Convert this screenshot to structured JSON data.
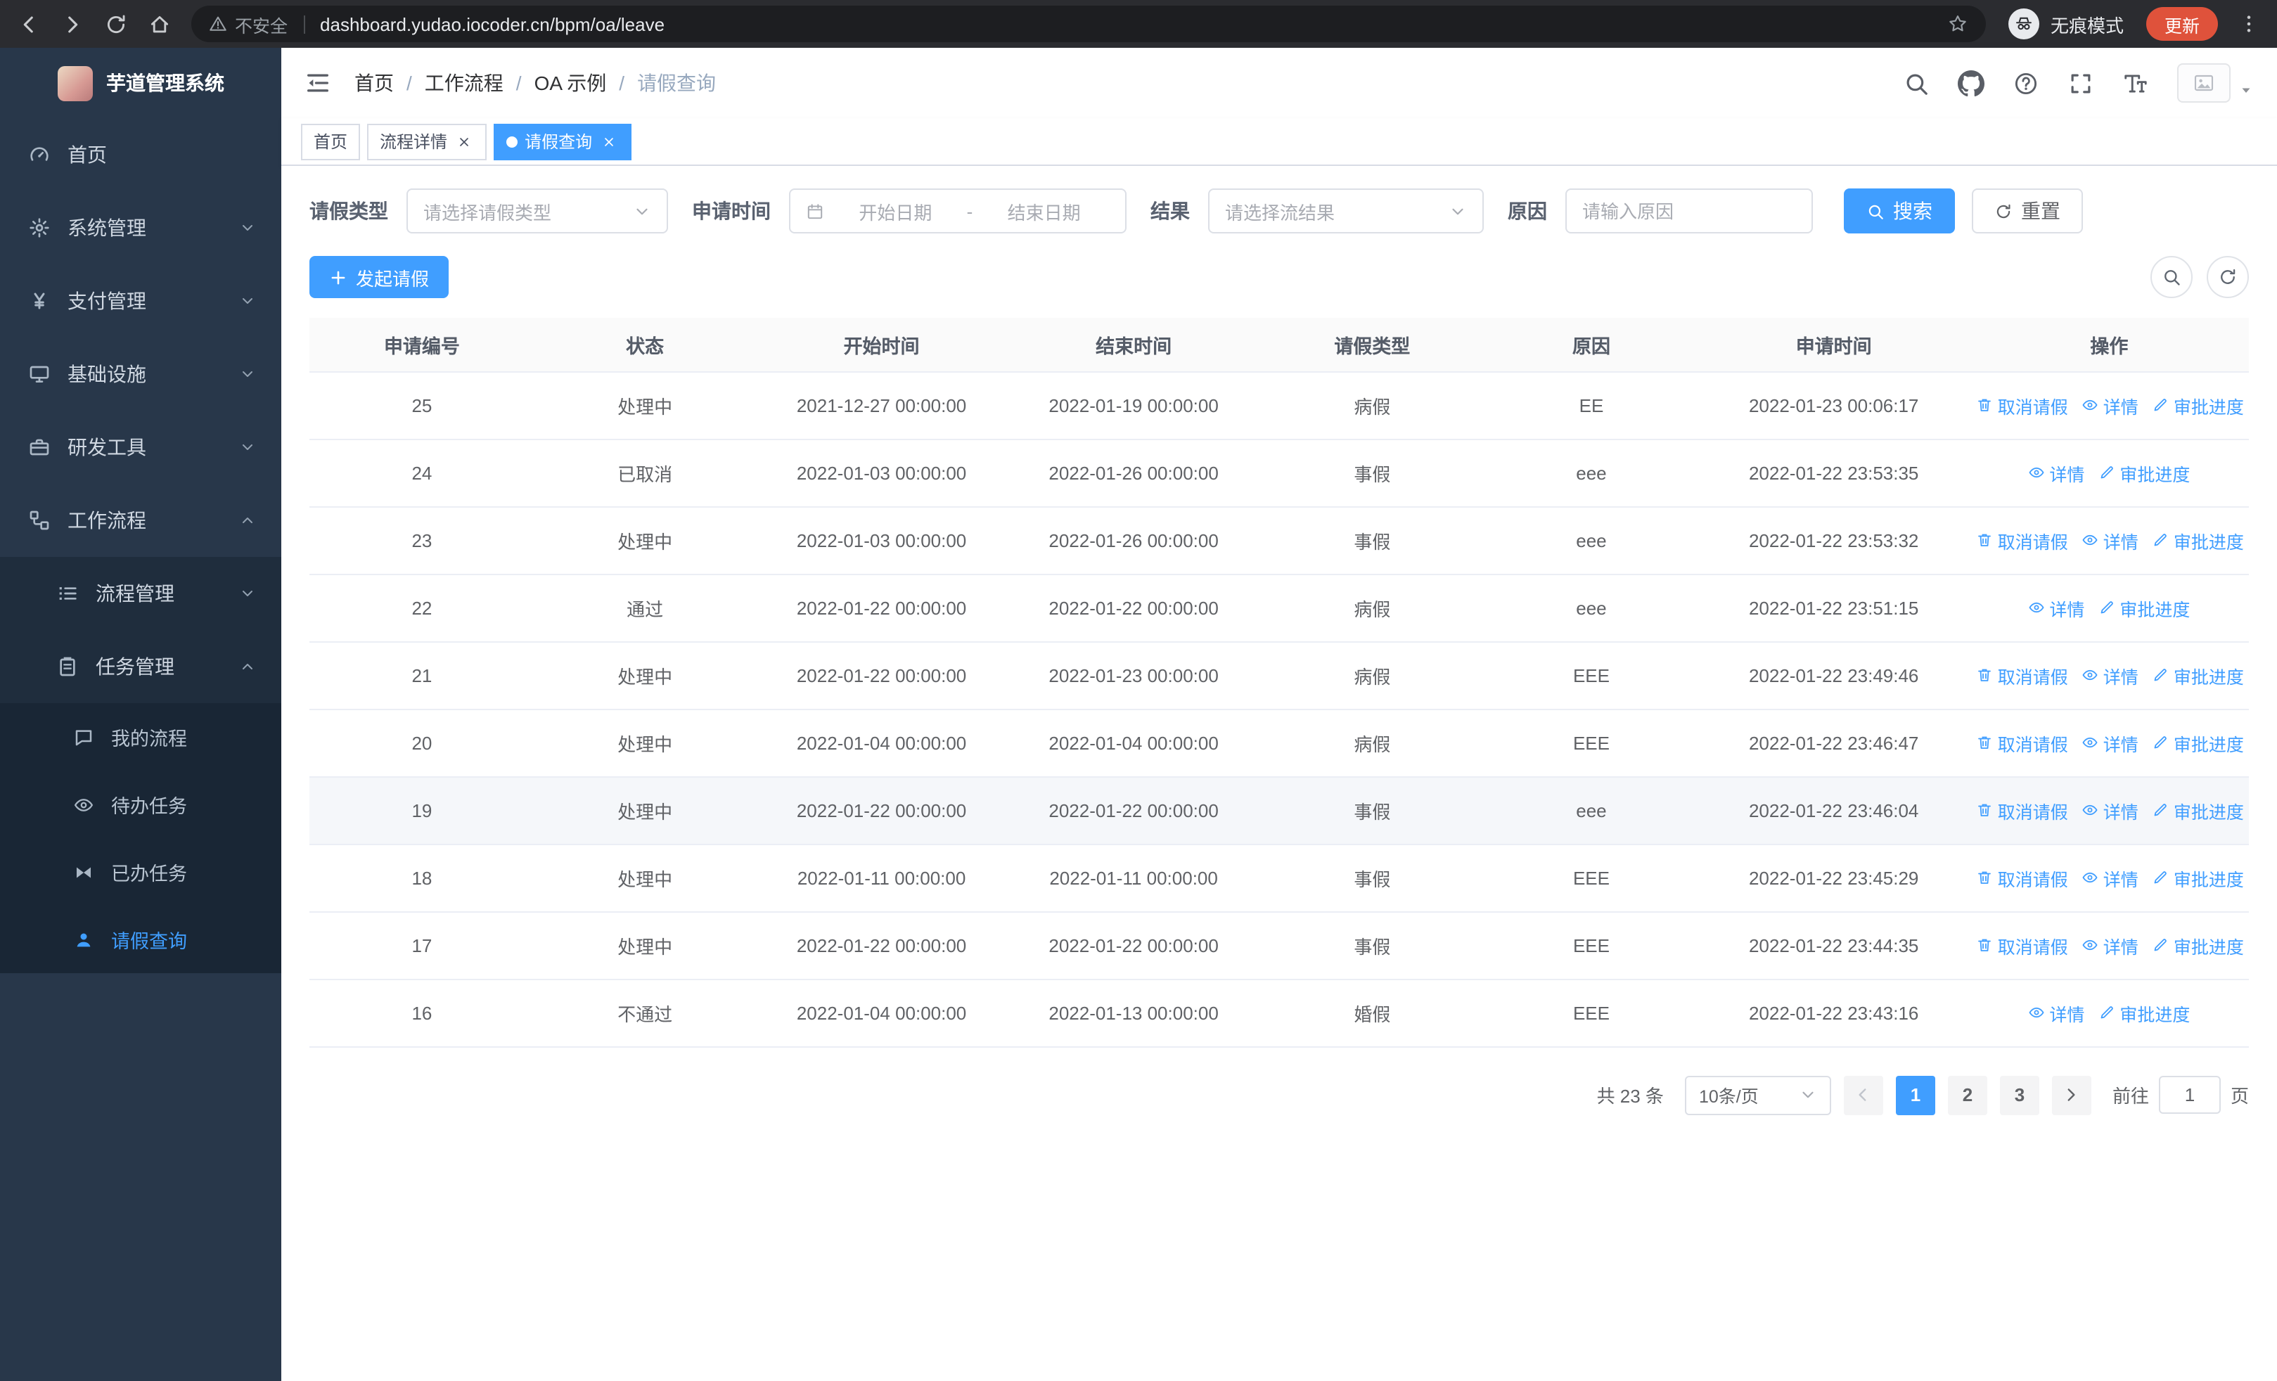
{
  "colors": {
    "accent": "#409eff",
    "update_button": "#df523b",
    "sidebar_bg": "#28374a",
    "sidebar_sub_bg": "#1f2d3d",
    "sidebar_sub2_bg": "#192635",
    "table_highlight": "#f5f7fa"
  },
  "browser": {
    "security_warning": "不安全",
    "url": "dashboard.yudao.iocoder.cn/bpm/oa/leave",
    "incognito_label": "无痕模式",
    "update_label": "更新"
  },
  "sidebar": {
    "title": "芋道管理系统",
    "menu": [
      {
        "label": "首页",
        "icon": "dashboard-icon",
        "level": 1
      },
      {
        "label": "系统管理",
        "icon": "gear-icon",
        "level": 1,
        "arrow": "down"
      },
      {
        "label": "支付管理",
        "icon": "payment-icon",
        "level": 1,
        "arrow": "down"
      },
      {
        "label": "基础设施",
        "icon": "monitor-icon",
        "level": 1,
        "arrow": "down"
      },
      {
        "label": "研发工具",
        "icon": "toolbox-icon",
        "level": 1,
        "arrow": "down"
      },
      {
        "label": "工作流程",
        "icon": "workflow-icon",
        "level": 1,
        "arrow": "up",
        "open": true
      },
      {
        "label": "流程管理",
        "icon": "list-icon",
        "level": 2,
        "arrow": "down"
      },
      {
        "label": "任务管理",
        "icon": "clipboard-icon",
        "level": 2,
        "arrow": "up",
        "open": true
      },
      {
        "label": "我的流程",
        "icon": "chat-icon",
        "level": 3
      },
      {
        "label": "待办任务",
        "icon": "eye-icon",
        "level": 3
      },
      {
        "label": "已办任务",
        "icon": "bowtie-icon",
        "level": 3
      },
      {
        "label": "请假查询",
        "icon": "user-icon",
        "level": 3,
        "active": true
      }
    ]
  },
  "header": {
    "breadcrumb": [
      "首页",
      "工作流程",
      "OA 示例",
      "请假查询"
    ],
    "breadcrumb_separator": "/",
    "icons": [
      "search-icon",
      "github-icon",
      "question-icon",
      "fullscreen-icon",
      "font-size-icon"
    ]
  },
  "tabs": [
    {
      "label": "首页",
      "closable": false,
      "active": false
    },
    {
      "label": "流程详情",
      "closable": true,
      "active": false
    },
    {
      "label": "请假查询",
      "closable": true,
      "active": true
    }
  ],
  "filters": {
    "leave_type_label": "请假类型",
    "leave_type_placeholder": "请选择请假类型",
    "apply_time_label": "申请时间",
    "start_placeholder": "开始日期",
    "range_separator": "-",
    "end_placeholder": "结束日期",
    "result_label": "结果",
    "result_placeholder": "请选择流结果",
    "reason_label": "原因",
    "reason_placeholder": "请输入原因",
    "search_button": "搜索",
    "reset_button": "重置"
  },
  "toolbar": {
    "create_button": "发起请假"
  },
  "table": {
    "columns": [
      "申请编号",
      "状态",
      "开始时间",
      "结束时间",
      "请假类型",
      "原因",
      "申请时间",
      "操作"
    ],
    "action_labels": {
      "cancel": "取消请假",
      "detail": "详情",
      "progress": "审批进度"
    },
    "rows": [
      {
        "id": "25",
        "status": "处理中",
        "start_time": "2021-12-27 00:00:00",
        "end_time": "2022-01-19 00:00:00",
        "leave_type": "病假",
        "reason": "EE",
        "apply_time": "2022-01-23 00:06:17",
        "actions": [
          "cancel",
          "detail",
          "progress"
        ],
        "highlighted": false
      },
      {
        "id": "24",
        "status": "已取消",
        "start_time": "2022-01-03 00:00:00",
        "end_time": "2022-01-26 00:00:00",
        "leave_type": "事假",
        "reason": "eee",
        "apply_time": "2022-01-22 23:53:35",
        "actions": [
          "detail",
          "progress"
        ],
        "highlighted": false
      },
      {
        "id": "23",
        "status": "处理中",
        "start_time": "2022-01-03 00:00:00",
        "end_time": "2022-01-26 00:00:00",
        "leave_type": "事假",
        "reason": "eee",
        "apply_time": "2022-01-22 23:53:32",
        "actions": [
          "cancel",
          "detail",
          "progress"
        ],
        "highlighted": false
      },
      {
        "id": "22",
        "status": "通过",
        "start_time": "2022-01-22 00:00:00",
        "end_time": "2022-01-22 00:00:00",
        "leave_type": "病假",
        "reason": "eee",
        "apply_time": "2022-01-22 23:51:15",
        "actions": [
          "detail",
          "progress"
        ],
        "highlighted": false
      },
      {
        "id": "21",
        "status": "处理中",
        "start_time": "2022-01-22 00:00:00",
        "end_time": "2022-01-23 00:00:00",
        "leave_type": "病假",
        "reason": "EEE",
        "apply_time": "2022-01-22 23:49:46",
        "actions": [
          "cancel",
          "detail",
          "progress"
        ],
        "highlighted": false
      },
      {
        "id": "20",
        "status": "处理中",
        "start_time": "2022-01-04 00:00:00",
        "end_time": "2022-01-04 00:00:00",
        "leave_type": "病假",
        "reason": "EEE",
        "apply_time": "2022-01-22 23:46:47",
        "actions": [
          "cancel",
          "detail",
          "progress"
        ],
        "highlighted": false
      },
      {
        "id": "19",
        "status": "处理中",
        "start_time": "2022-01-22 00:00:00",
        "end_time": "2022-01-22 00:00:00",
        "leave_type": "事假",
        "reason": "eee",
        "apply_time": "2022-01-22 23:46:04",
        "actions": [
          "cancel",
          "detail",
          "progress"
        ],
        "highlighted": true
      },
      {
        "id": "18",
        "status": "处理中",
        "start_time": "2022-01-11 00:00:00",
        "end_time": "2022-01-11 00:00:00",
        "leave_type": "事假",
        "reason": "EEE",
        "apply_time": "2022-01-22 23:45:29",
        "actions": [
          "cancel",
          "detail",
          "progress"
        ],
        "highlighted": false
      },
      {
        "id": "17",
        "status": "处理中",
        "start_time": "2022-01-22 00:00:00",
        "end_time": "2022-01-22 00:00:00",
        "leave_type": "事假",
        "reason": "EEE",
        "apply_time": "2022-01-22 23:44:35",
        "actions": [
          "cancel",
          "detail",
          "progress"
        ],
        "highlighted": false
      },
      {
        "id": "16",
        "status": "不通过",
        "start_time": "2022-01-04 00:00:00",
        "end_time": "2022-01-13 00:00:00",
        "leave_type": "婚假",
        "reason": "EEE",
        "apply_time": "2022-01-22 23:43:16",
        "actions": [
          "detail",
          "progress"
        ],
        "highlighted": false
      }
    ]
  },
  "pagination": {
    "total": "共 23 条",
    "page_size": "10条/页",
    "pages": [
      "1",
      "2",
      "3"
    ],
    "active_page": "1",
    "goto_label": "前往",
    "goto_value": "1",
    "unit_label": "页"
  }
}
